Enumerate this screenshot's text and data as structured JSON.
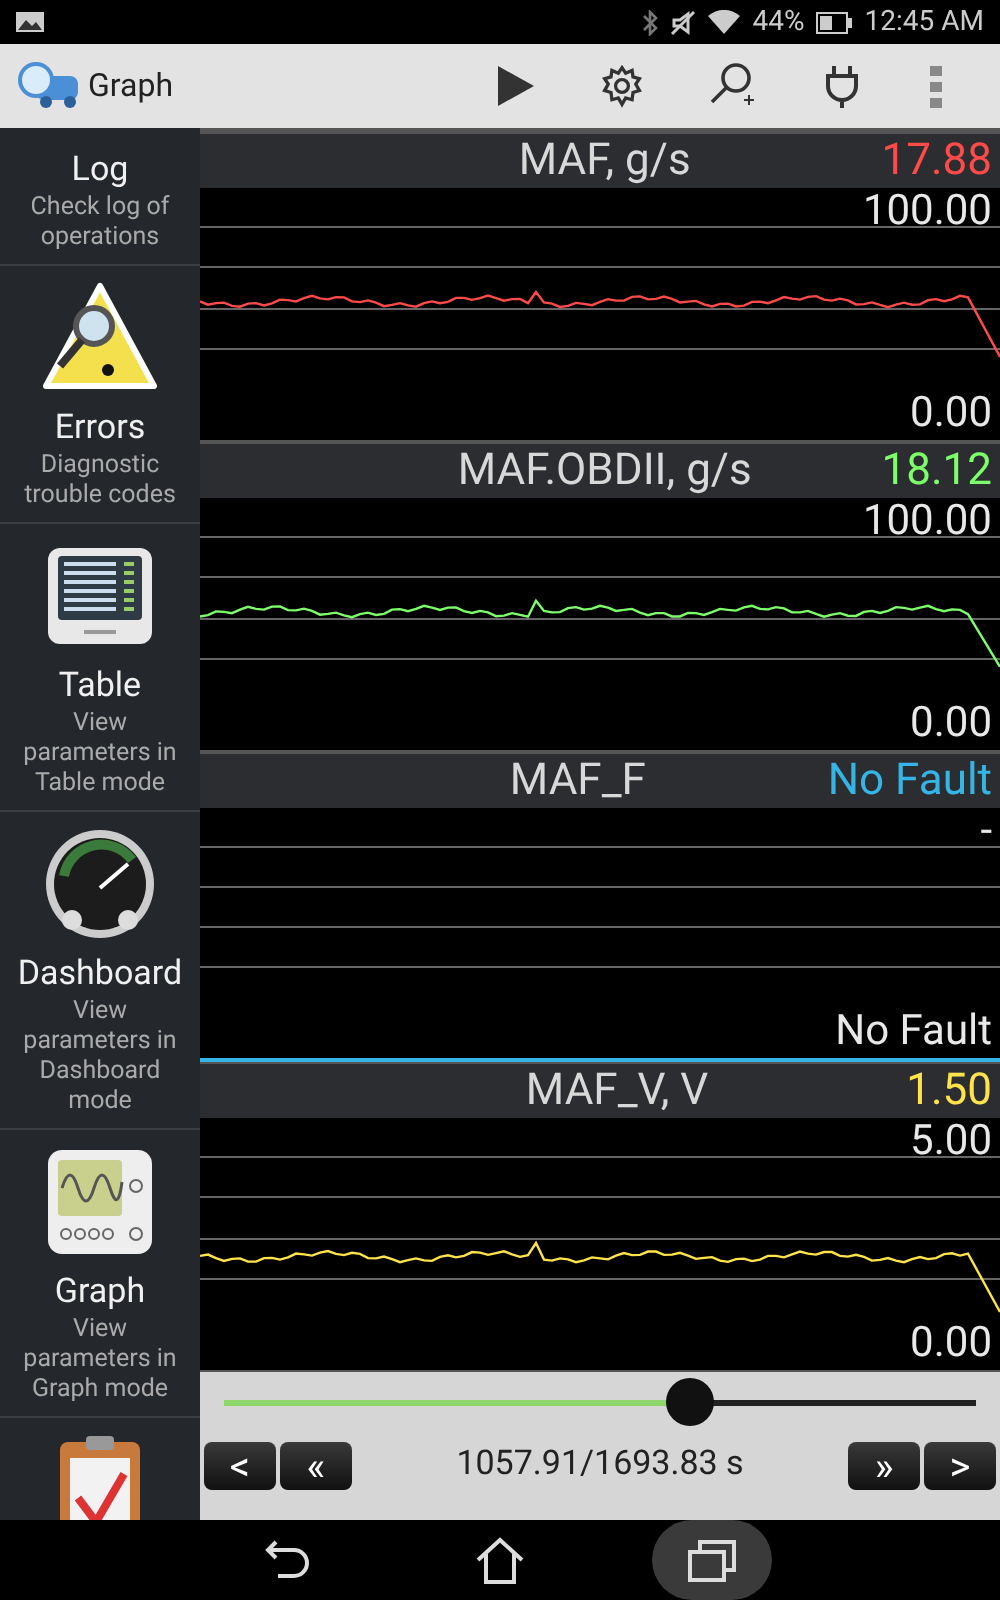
{
  "status_bar": {
    "battery": "44%",
    "time": "12:45 AM"
  },
  "app_bar": {
    "title": "Graph"
  },
  "sidebar": {
    "items": [
      {
        "title": "Log",
        "subtitle": "Check log of operations"
      },
      {
        "title": "Errors",
        "subtitle": "Diagnostic trouble codes",
        "kind": "warning"
      },
      {
        "title": "Table",
        "subtitle": "View parameters in Table mode",
        "kind": "table"
      },
      {
        "title": "Dashboard",
        "subtitle": "View parameters in Dashboard mode",
        "kind": "gauge"
      },
      {
        "title": "Graph",
        "subtitle": "View parameters in Graph mode",
        "kind": "oscilloscope"
      },
      {
        "kind": "clipboard"
      }
    ]
  },
  "graphs": [
    {
      "kind": "numeric",
      "name": "MAF, g/s",
      "value": "17.88",
      "color": "#ff4a4a",
      "max": "100.00",
      "min": "0.00"
    },
    {
      "kind": "numeric",
      "name": "MAF.OBDII, g/s",
      "value": "18.12",
      "color": "#7dff6a",
      "max": "100.00",
      "min": "0.00"
    },
    {
      "kind": "status",
      "name": "MAF_F",
      "value": "No Fault",
      "color": "#35b5e5",
      "max": "-",
      "min": "No Fault"
    },
    {
      "kind": "numeric",
      "name": "MAF_V, V",
      "value": "1.50",
      "color": "#ffe34a",
      "max": "5.00",
      "min": "0.00"
    }
  ],
  "playback": {
    "level": 0.62,
    "buttons_left": [
      "<",
      "«"
    ],
    "position": "1057.91/1693.83 s",
    "buttons_right": [
      "»",
      ">"
    ]
  },
  "nav_bar": [
    {
      "kind": "back",
      "pressed": false
    },
    {
      "kind": "home",
      "pressed": false
    },
    {
      "kind": "recents",
      "pressed": true
    }
  ]
}
